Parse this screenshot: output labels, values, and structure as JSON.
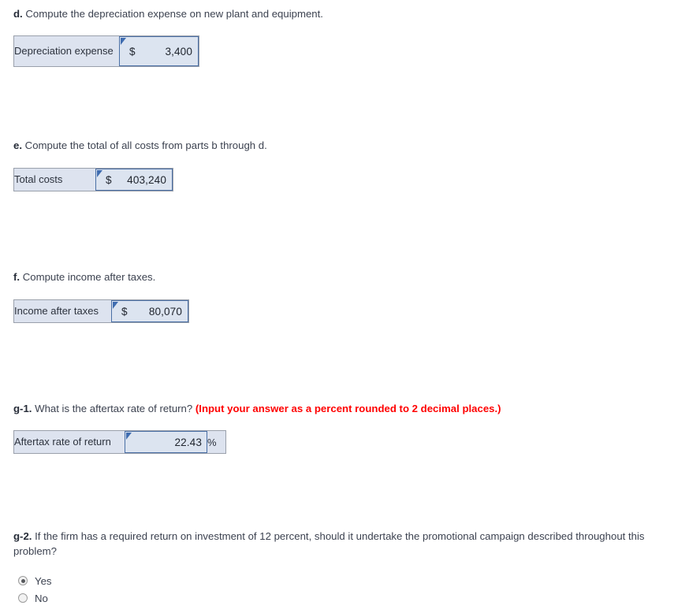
{
  "sections": [
    {
      "id": "d",
      "label": "d.",
      "text": " Compute the depreciation expense on new plant and equipment.",
      "hint": "",
      "row": {
        "label": "Depreciation expense",
        "currency": "$",
        "value": "3,400",
        "suffix": ""
      }
    },
    {
      "id": "e",
      "label": "e.",
      "text": " Compute the total of all costs from parts b through d.",
      "hint": "",
      "row": {
        "label": "Total costs",
        "currency": "$",
        "value": "403,240",
        "suffix": ""
      }
    },
    {
      "id": "f",
      "label": "f.",
      "text": " Compute income after taxes.",
      "hint": "",
      "row": {
        "label": "Income after taxes",
        "currency": "$",
        "value": "80,070",
        "suffix": ""
      }
    },
    {
      "id": "g1",
      "label": "g-1.",
      "text": " What is the aftertax rate of return? ",
      "hint": "(Input your answer as a percent rounded to 2 decimal places.)",
      "row": {
        "label": "Aftertax rate of return",
        "currency": "",
        "value": "22.43",
        "suffix": "%"
      }
    },
    {
      "id": "g2",
      "label": "g-2.",
      "text": " If the firm has a required return on investment of 12 percent, should it undertake the promotional campaign described throughout this problem?",
      "hint": "",
      "options": [
        {
          "label": "Yes",
          "selected": true
        },
        {
          "label": "No",
          "selected": false
        }
      ]
    }
  ],
  "colors": {
    "hint_red": "#ff0000",
    "input_border_blue": "#4a6fa5",
    "cell_background": "#dde3ef",
    "flag_blue": "#3f6cb0",
    "text": "#3c4250"
  }
}
